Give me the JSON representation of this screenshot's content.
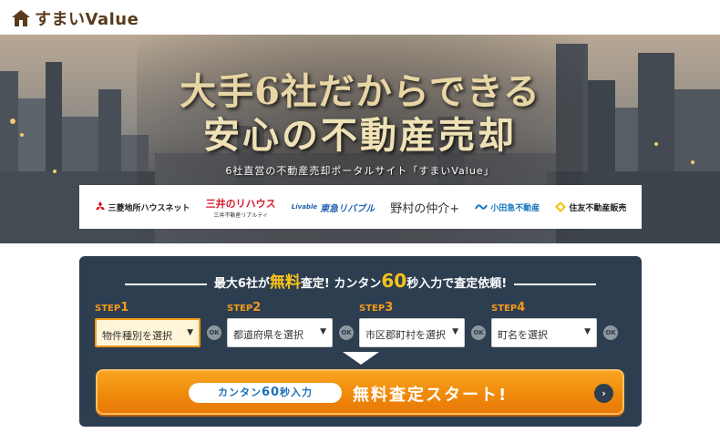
{
  "brand": {
    "logo_text": "すまいValue",
    "brand_color": "#5a3a1c"
  },
  "hero": {
    "title_line1": "大手6社だからできる",
    "title_line2": "安心の不動産売却",
    "subtitle": "6社直営の不動産売却ポータルサイト「すまいValue」",
    "partners": [
      {
        "name": "三菱地所ハウスネット"
      },
      {
        "name": "三井のリハウス",
        "sub": "三井不動産リアルティ"
      },
      {
        "name": "東急リバブル",
        "mark": "Livable"
      },
      {
        "name": "野村の仲介+"
      },
      {
        "name": "小田急不動産"
      },
      {
        "name": "住友不動産販売"
      }
    ]
  },
  "form": {
    "heading_pre": "最大6社が",
    "heading_hl": "無料",
    "heading_mid": "査定! カンタン",
    "heading_num": "60",
    "heading_post": "秒入力で査定依頼!",
    "steps": [
      {
        "label": "STEP",
        "num": "1",
        "select": "物件種別を選択"
      },
      {
        "label": "STEP",
        "num": "2",
        "select": "都道府県を選択"
      },
      {
        "label": "STEP",
        "num": "3",
        "select": "市区郡町村を選択"
      },
      {
        "label": "STEP",
        "num": "4",
        "select": "町名を選択"
      }
    ],
    "ok_label": "OK",
    "cta_pill_pre": "カンタン",
    "cta_pill_num": "60",
    "cta_pill_post": "秒入力",
    "cta_text": "無料査定スタート!",
    "cta_arrow": "›",
    "accent_color": "#f39a1a",
    "panel_color": "#2d3e50"
  }
}
